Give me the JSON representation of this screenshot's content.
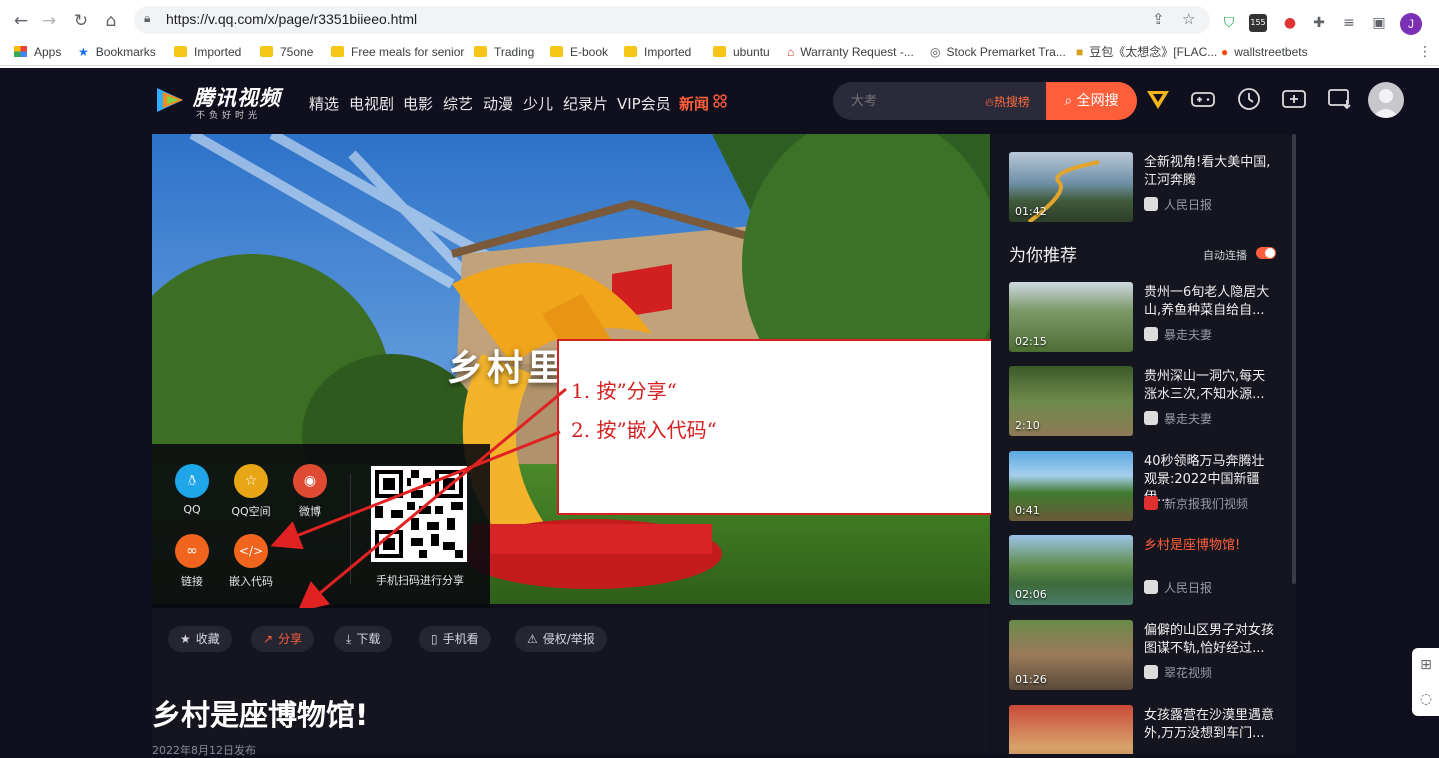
{
  "browser": {
    "url": "https://v.qq.com/x/page/r3351biieeo.html",
    "badge_count": "155",
    "profile_initial": "J",
    "bookmarks": [
      {
        "label": "Apps",
        "icon": "apps-grid-icon"
      },
      {
        "label": "Bookmarks",
        "icon": "star-icon"
      },
      {
        "label": "Imported",
        "icon": "folder-icon"
      },
      {
        "label": "75one",
        "icon": "folder-icon"
      },
      {
        "label": "Free meals for senior",
        "icon": "folder-icon"
      },
      {
        "label": "Trading",
        "icon": "folder-icon"
      },
      {
        "label": "E-book",
        "icon": "folder-icon"
      },
      {
        "label": "Imported",
        "icon": "folder-icon"
      },
      {
        "label": "ubuntu",
        "icon": "folder-icon"
      },
      {
        "label": "Warranty Request -...",
        "icon": "house-icon"
      },
      {
        "label": "Stock Premarket Tra...",
        "icon": "globe-icon"
      },
      {
        "label": "豆包《太想念》[FLAC...",
        "icon": "image-icon"
      },
      {
        "label": "wallstreetbets",
        "icon": "reddit-icon"
      }
    ]
  },
  "header": {
    "logo_text": "腾讯视频",
    "logo_slogan": "不负好时光",
    "nav": [
      "精选",
      "电视剧",
      "电影",
      "综艺",
      "动漫",
      "少儿",
      "纪录片",
      "VIP会员",
      "新闻"
    ],
    "nav_active": "新闻",
    "search_placeholder": "大考",
    "hot_search": "热搜榜",
    "search_button": "全网搜",
    "accent": "#ff5e3a"
  },
  "player": {
    "caption": "乡村里",
    "share": {
      "options": [
        "QQ",
        "QQ空间",
        "微博",
        "链接",
        "嵌入代码"
      ],
      "qr_label": "手机扫码进行分享"
    }
  },
  "annotation": {
    "line1": "1. 按”分享“",
    "line2": "2. 按”嵌入代码“",
    "color": "#d42020"
  },
  "actions": [
    "收藏",
    "分享",
    "下载",
    "手机看",
    "侵权/举报"
  ],
  "video": {
    "title": "乡村是座博物馆!",
    "published": "2022年8月12日发布"
  },
  "sidebar": {
    "top_item": {
      "title": "全新视角!看大美中国,江河奔腾",
      "source": "人民日报",
      "duration": "01:42"
    },
    "section_title": "为你推荐",
    "autoplay_label": "自动连播",
    "items": [
      {
        "title": "贵州一6旬老人隐居大山,养鱼种菜自给自...",
        "source": "暴走夫妻",
        "duration": "02:15"
      },
      {
        "title": "贵州深山一洞穴,每天涨水三次,不知水源...",
        "source": "暴走夫妻",
        "duration": "2:10"
      },
      {
        "title": "40秒领略万马奔腾壮观景:2022中国新疆伊...",
        "source": "新京报我们视频",
        "duration": "0:41"
      },
      {
        "title": "乡村是座博物馆!",
        "source": "人民日报",
        "duration": "02:06"
      },
      {
        "title": "偏僻的山区男子对女孩图谋不轨,恰好经过...",
        "source": "翠花视频",
        "duration": "01:26"
      },
      {
        "title": "女孩露营在沙漠里遇意外,万万没想到车门...",
        "source": "",
        "duration": ""
      }
    ]
  }
}
